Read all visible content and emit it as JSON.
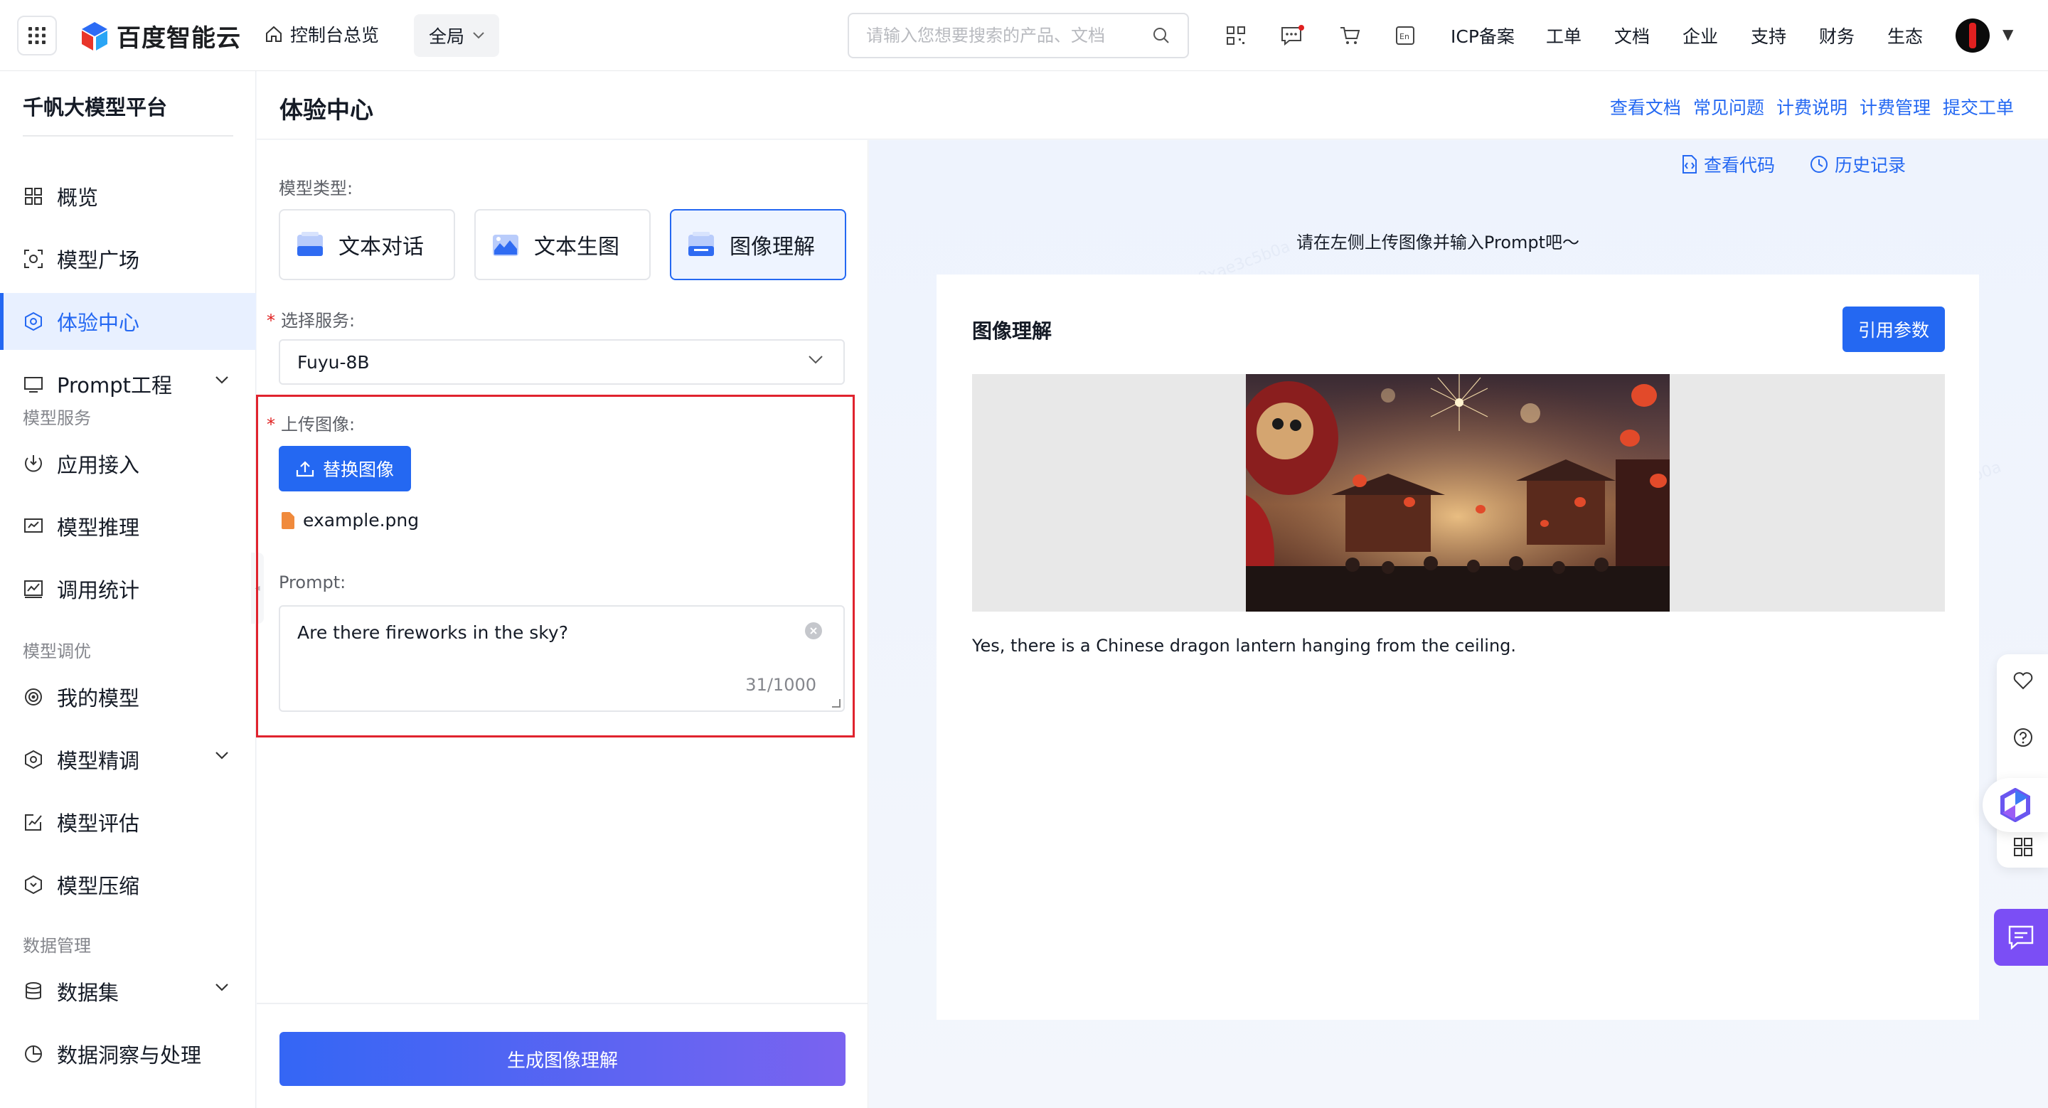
{
  "topnav": {
    "brand": "百度智能云",
    "home_label": "控制台总览",
    "scope_label": "全局",
    "search_placeholder": "请输入您想要搜索的产品、文档",
    "links": [
      "ICP备案",
      "工单",
      "文档",
      "企业",
      "支持",
      "财务",
      "生态"
    ]
  },
  "sidebar": {
    "title": "千帆大模型平台",
    "items": [
      {
        "label": "概览",
        "icon": "grid-icon"
      },
      {
        "label": "模型广场",
        "icon": "model-square-icon"
      },
      {
        "label": "体验中心",
        "icon": "experience-icon",
        "active": true
      },
      {
        "label": "Prompt工程",
        "icon": "prompt-icon",
        "expandable": true
      }
    ],
    "group_model_service": "模型服务",
    "service_items": [
      {
        "label": "应用接入",
        "icon": "app-access-icon"
      },
      {
        "label": "模型推理",
        "icon": "inference-icon"
      },
      {
        "label": "调用统计",
        "icon": "stats-icon"
      }
    ],
    "group_model_tuning": "模型调优",
    "tuning_items": [
      {
        "label": "我的模型",
        "icon": "my-model-icon"
      },
      {
        "label": "模型精调",
        "icon": "finetune-icon",
        "expandable": true
      },
      {
        "label": "模型评估",
        "icon": "evaluate-icon"
      },
      {
        "label": "模型压缩",
        "icon": "compress-icon"
      }
    ],
    "group_data": "数据管理",
    "data_items": [
      {
        "label": "数据集",
        "icon": "dataset-icon",
        "expandable": true
      },
      {
        "label": "数据洞察与处理",
        "icon": "insight-icon"
      }
    ]
  },
  "header": {
    "title": "体验中心",
    "links": [
      "查看文档",
      "常见问题",
      "计费说明",
      "计费管理",
      "提交工单"
    ]
  },
  "form": {
    "model_type_label": "模型类型:",
    "model_types": [
      "文本对话",
      "文本生图",
      "图像理解"
    ],
    "selected_type": "图像理解",
    "service_label": "选择服务:",
    "service_value": "Fuyu-8B",
    "upload_label": "上传图像:",
    "upload_button": "替换图像",
    "file_name": "example.png",
    "prompt_label": "Prompt:",
    "prompt_value": "Are there fireworks in the sky?",
    "char_count": "31/1000",
    "generate_button": "生成图像理解"
  },
  "result": {
    "view_code": "查看代码",
    "history": "历史记录",
    "hint": "请在左侧上传图像并输入Prompt吧～",
    "card_title": "图像理解",
    "cite_button": "引用参数",
    "answer": "Yes, there is a Chinese dragon lantern hanging from the ceiling."
  },
  "colors": {
    "primary": "#2468f2",
    "highlight": "#e0232e",
    "chat": "#7b4ef5"
  }
}
